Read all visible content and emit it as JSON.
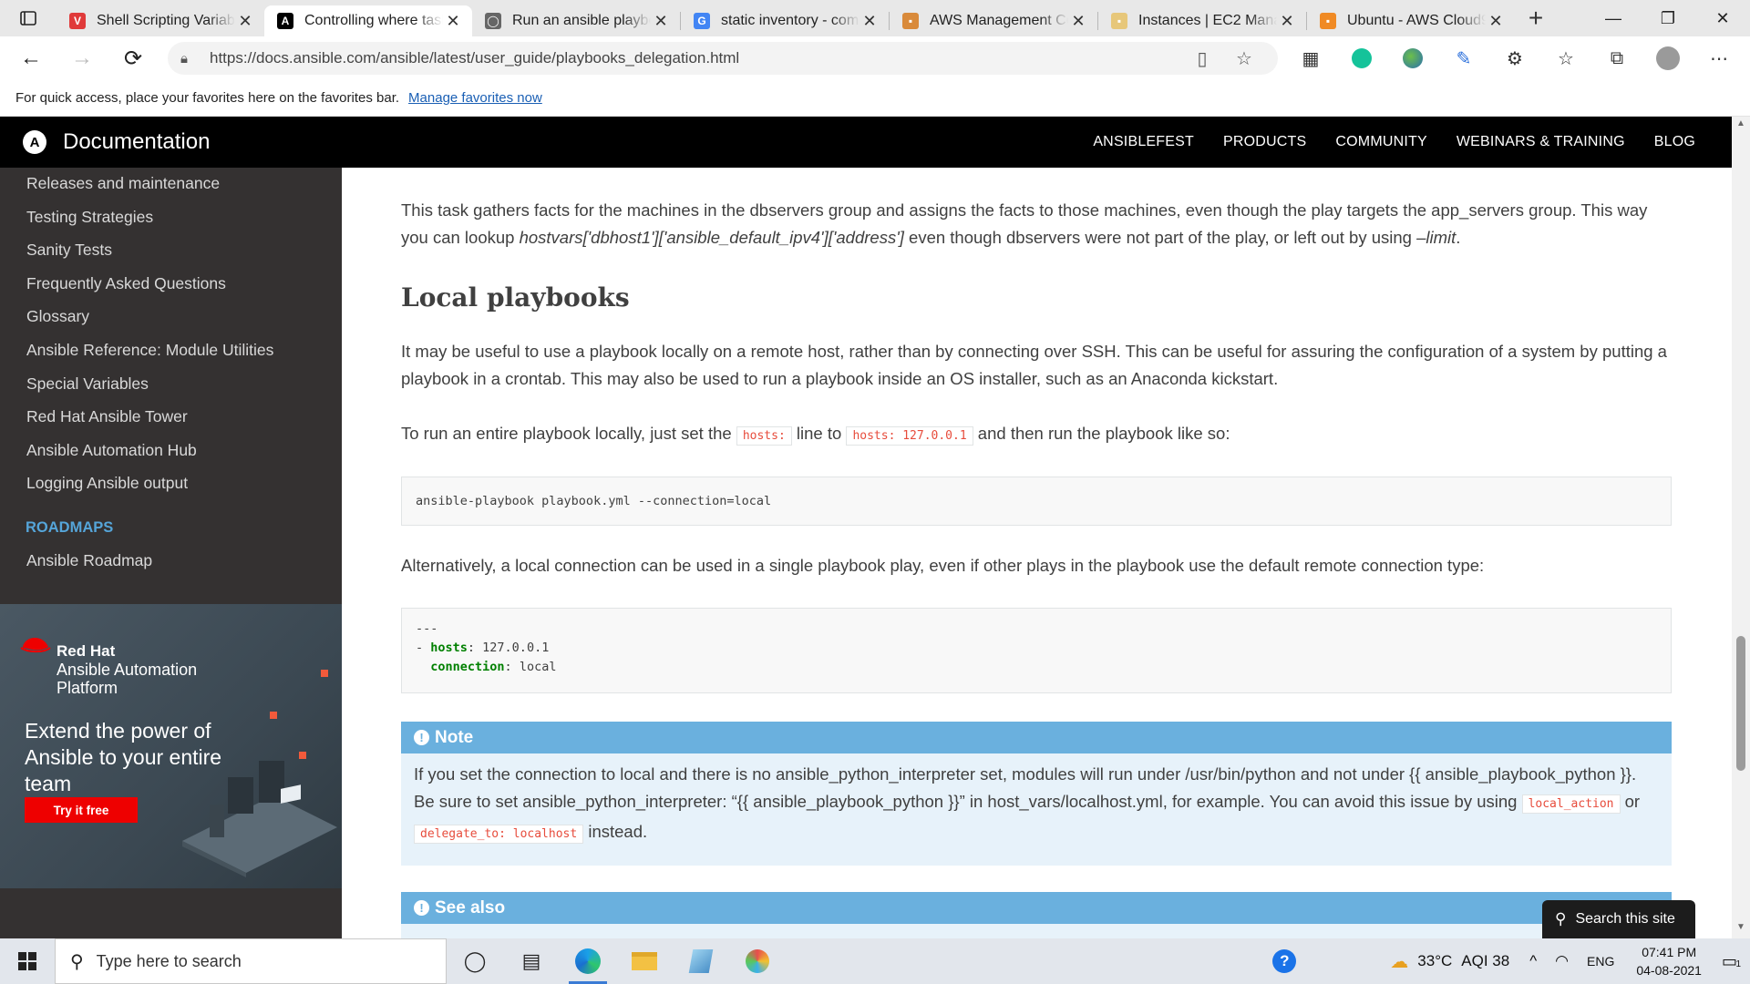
{
  "browser": {
    "tabs": [
      {
        "title": "Shell Scripting Variabl",
        "favicon_color": "#e03a3a",
        "favicon_glyph": "V"
      },
      {
        "title": "Controlling where tasl",
        "favicon_color": "#000000",
        "favicon_glyph": "A"
      },
      {
        "title": "Run an ansible playbo",
        "favicon_color": "#666666",
        "favicon_glyph": "◯"
      },
      {
        "title": "static inventory - com",
        "favicon_color": "#4285f4",
        "favicon_glyph": "G"
      },
      {
        "title": "AWS Management Co",
        "favicon_color": "#d98a3a",
        "favicon_glyph": "▪"
      },
      {
        "title": "Instances | EC2 Mana",
        "favicon_color": "#e7c77a",
        "favicon_glyph": "▪"
      },
      {
        "title": "Ubuntu - AWS Cloud9",
        "favicon_color": "#f08a24",
        "favicon_glyph": "▪"
      }
    ],
    "active_tab": 1,
    "url": "https://docs.ansible.com/ansible/latest/user_guide/playbooks_delegation.html",
    "favorites_prompt": "For quick access, place your favorites here on the favorites bar.",
    "favorites_link": "Manage favorites now"
  },
  "site": {
    "logo_letter": "A",
    "title": "Documentation",
    "nav": [
      "ANSIBLEFEST",
      "PRODUCTS",
      "COMMUNITY",
      "WEBINARS & TRAINING",
      "BLOG"
    ]
  },
  "sidebar": {
    "items": [
      "Releases and maintenance",
      "Testing Strategies",
      "Sanity Tests",
      "Frequently Asked Questions",
      "Glossary",
      "Ansible Reference: Module Utilities",
      "Special Variables",
      "Red Hat Ansible Tower",
      "Ansible Automation Hub",
      "Logging Ansible output"
    ],
    "caption": "ROADMAPS",
    "caption_items": [
      "Ansible Roadmap"
    ]
  },
  "ad": {
    "brand": "Red Hat",
    "product": "Ansible Automation Platform",
    "headline": "Extend the power of Ansible to your entire team",
    "cta": "Try it free"
  },
  "content": {
    "facts_para_1": "This task gathers facts for the machines in the dbservers group and assigns the facts to those machines, even though the play targets the app_servers group. This way you can lookup ",
    "facts_para_italic": "hostvars['dbhost1']['ansible_default_ipv4']['address']",
    "facts_para_2": " even though dbservers were not part of the play, or left out by using ",
    "facts_para_italic2": "–limit",
    "facts_para_end": ".",
    "heading": "Local playbooks",
    "local_para": "It may be useful to use a playbook locally on a remote host, rather than by connecting over SSH. This can be useful for assuring the configuration of a system by putting a playbook in a crontab. This may also be used to run a playbook inside an OS installer, such as an Anaconda kickstart.",
    "run_para_a": "To run an entire playbook locally, just set the ",
    "run_code_1": "hosts:",
    "run_para_b": " line to ",
    "run_code_2": "hosts: 127.0.0.1",
    "run_para_c": " and then run the playbook like so:",
    "code_1": "ansible-playbook playbook.yml --connection=local",
    "alt_para": "Alternatively, a local connection can be used in a single playbook play, even if other plays in the playbook use the default remote connection type:",
    "yaml_sep": "---",
    "yaml_dash": "- ",
    "yaml_key_1": "hosts",
    "yaml_val_1": "127.0.0.1",
    "yaml_key_2": "connection",
    "yaml_val_2": "local",
    "note_title": "Note",
    "note_text_a": "If you set the connection to local and there is no ansible_python_interpreter set, modules will run under /usr/bin/python and not under {{ ansible_playbook_python }}. Be sure to set ansible_python_interpreter: “{{ ansible_playbook_python }}” in host_vars/localhost.yml, for example. You can avoid this issue by using ",
    "note_code_1": "local_action",
    "note_text_b": " or ",
    "note_code_2": "delegate_to: localhost",
    "note_text_c": " instead.",
    "see_also_title": "See also",
    "search_widget": "Search this site"
  },
  "taskbar": {
    "search_placeholder": "Type here to search",
    "weather": "33°C",
    "aqi": "AQI 38",
    "lang": "ENG",
    "time": "07:41 PM",
    "date": "04-08-2021",
    "notif_count": "1"
  },
  "colors": {
    "sidebar_bg": "#343131",
    "caption": "#55a5d9",
    "admonition_title": "#6ab0de",
    "admonition_bg": "#e7f2fa",
    "code_literal": "#e74c3c"
  }
}
